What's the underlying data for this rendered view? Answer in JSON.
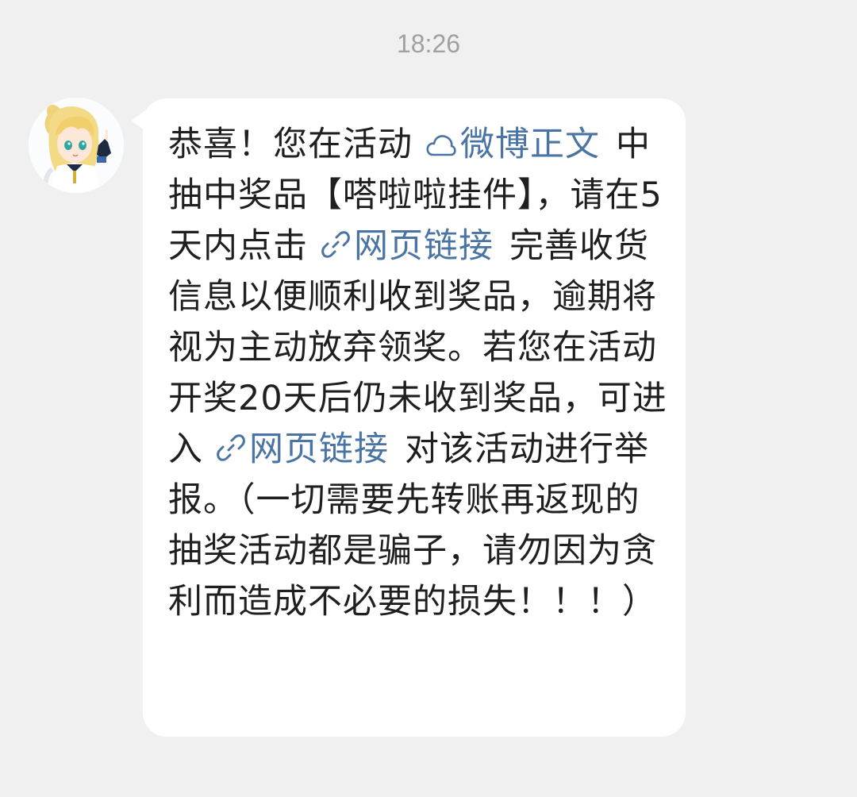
{
  "chat": {
    "timestamp": "18:26"
  },
  "message": {
    "seg_1": "恭喜！您在活动",
    "link_1": "微博正文",
    "seg_2": "中抽中奖品【嗒啦啦挂件】，请在5天内点击",
    "link_2": "网页链接",
    "seg_3": "完善收货信息以便顺利收到奖品，逾期将视为主动放弃领奖。若您在活动开奖20天后仍未收到奖品，可进入",
    "link_3": "网页链接",
    "seg_4": "对该活动进行举报。（一切需要先转账再返现的抽奖活动都是骗子，请勿因为贪利而造成不必要的损失！！！）",
    "link_1_icon": "weibo-cloud-icon",
    "link_2_icon": "chain-link-icon",
    "link_3_icon": "chain-link-icon"
  },
  "colors": {
    "background": "#f0f0f0",
    "bubble": "#ffffff",
    "text": "#1f1f1f",
    "link": "#4a74a3",
    "timestamp": "#a0a0a0"
  }
}
